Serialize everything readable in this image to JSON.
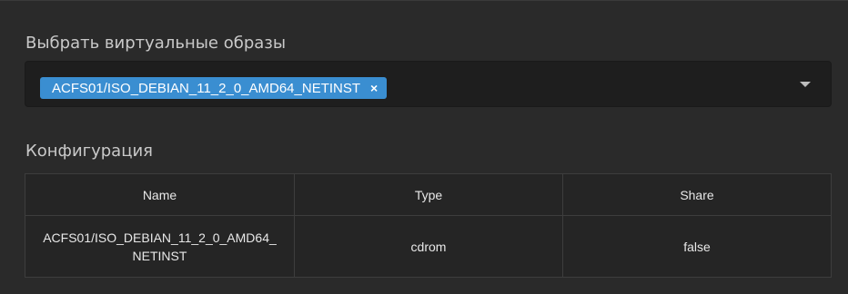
{
  "iso_selector": {
    "label": "Выбрать виртуальные образы",
    "selected": [
      {
        "label": "ACFS01/ISO_DEBIAN_11_2_0_AMD64_NETINST",
        "remove_symbol": "×"
      }
    ],
    "caret_icon": "chevron-down-icon",
    "tag_color": "#3a8ed1"
  },
  "configuration": {
    "label": "Конфигурация",
    "columns": [
      "Name",
      "Type",
      "Share"
    ],
    "rows": [
      {
        "name_line1": "ACFS01/ISO_DEBIAN_11_2_0_AMD64_",
        "name_line2": "NETINST",
        "type": "cdrom",
        "share": "false"
      }
    ]
  }
}
